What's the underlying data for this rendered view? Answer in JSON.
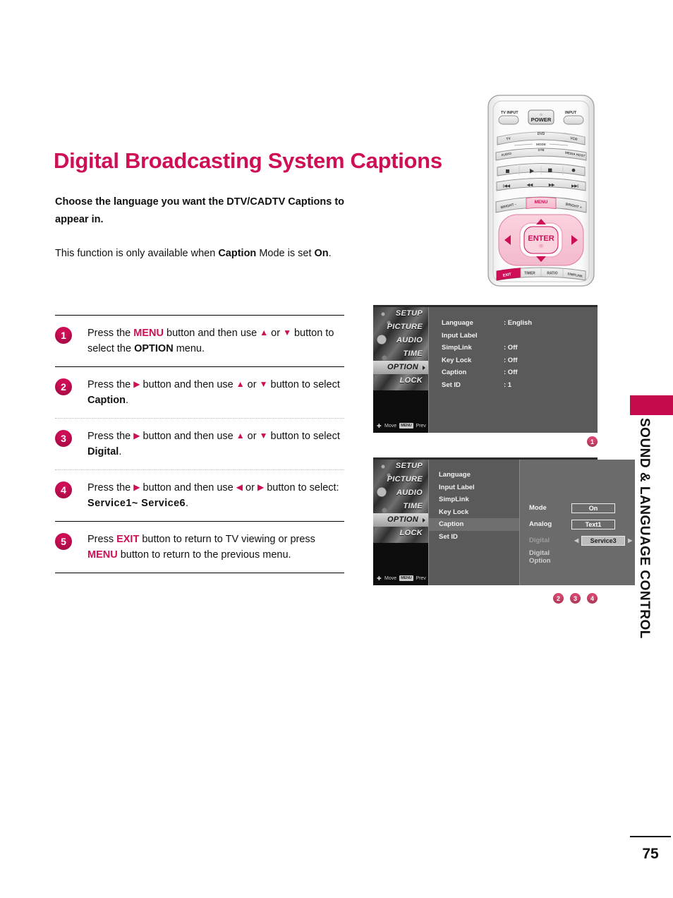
{
  "document": {
    "title": "Digital Broadcasting System Captions",
    "page_number": "75",
    "side_tab_title": "SOUND & LANGUAGE CONTROL"
  },
  "intro": {
    "paragraph1": "Choose the language you want the DTV/CADTV Captions to appear in.",
    "paragraph2_pre": "This function is only available when ",
    "paragraph2_bold1": "Caption",
    "paragraph2_mid": " Mode is set ",
    "paragraph2_bold2": "On",
    "paragraph2_post": "."
  },
  "steps": [
    {
      "number": "1",
      "segments": [
        {
          "t": "Press the ",
          "s": "plain"
        },
        {
          "t": "MENU",
          "s": "pink"
        },
        {
          "t": " button and then use ",
          "s": "plain"
        },
        {
          "t": "up-arrow",
          "s": "icon"
        },
        {
          "t": " or ",
          "s": "plain"
        },
        {
          "t": "down-arrow",
          "s": "icon"
        },
        {
          "t": " button to select the ",
          "s": "plain"
        },
        {
          "t": "OPTION",
          "s": "bold"
        },
        {
          "t": " menu.",
          "s": "plain"
        }
      ]
    },
    {
      "number": "2",
      "segments": [
        {
          "t": "Press the ",
          "s": "plain"
        },
        {
          "t": "right-arrow",
          "s": "icon"
        },
        {
          "t": " button and then use ",
          "s": "plain"
        },
        {
          "t": "up-arrow",
          "s": "icon"
        },
        {
          "t": " or ",
          "s": "plain"
        },
        {
          "t": "down-arrow",
          "s": "icon"
        },
        {
          "t": " button to select ",
          "s": "plain"
        },
        {
          "t": "Caption",
          "s": "bold"
        },
        {
          "t": ".",
          "s": "plain"
        }
      ]
    },
    {
      "number": "3",
      "segments": [
        {
          "t": "Press the ",
          "s": "plain"
        },
        {
          "t": "right-arrow",
          "s": "icon"
        },
        {
          "t": " button and then use ",
          "s": "plain"
        },
        {
          "t": "up-arrow",
          "s": "icon"
        },
        {
          "t": " or ",
          "s": "plain"
        },
        {
          "t": "down-arrow",
          "s": "icon"
        },
        {
          "t": " button to select ",
          "s": "plain"
        },
        {
          "t": "Digital",
          "s": "bold"
        },
        {
          "t": ".",
          "s": "plain"
        }
      ]
    },
    {
      "number": "4",
      "segments": [
        {
          "t": "Press the ",
          "s": "plain"
        },
        {
          "t": "right-arrow",
          "s": "icon"
        },
        {
          "t": " button and then use ",
          "s": "plain"
        },
        {
          "t": "left-arrow",
          "s": "icon"
        },
        {
          "t": " or ",
          "s": "plain"
        },
        {
          "t": "right-arrow",
          "s": "icon"
        },
        {
          "t": " button to select: ",
          "s": "plain"
        },
        {
          "t": "Service1~ Service6",
          "s": "service"
        },
        {
          "t": ".",
          "s": "plain"
        }
      ]
    },
    {
      "number": "5",
      "segments": [
        {
          "t": "Press ",
          "s": "plain"
        },
        {
          "t": "EXIT",
          "s": "pink"
        },
        {
          "t": " button to return to TV viewing or press ",
          "s": "plain"
        },
        {
          "t": "MENU",
          "s": "pink"
        },
        {
          "t": " button to return to the previous menu.",
          "s": "plain"
        }
      ]
    }
  ],
  "remote": {
    "tv_input": "TV INPUT",
    "power": "POWER",
    "input": "INPUT",
    "mode_label": "MODE",
    "source_row1": [
      "TV",
      "DVD",
      "VCR"
    ],
    "source_row2": [
      "AUDIO",
      "STB",
      "MEDIA HOST"
    ],
    "bright_minus": "BRIGHT -",
    "menu": "MENU",
    "bright_plus": "BRIGHT +",
    "enter": "ENTER",
    "exit": "EXIT",
    "timer": "TIMER",
    "ratio": "RATIO",
    "simplink": "SIMPLINK"
  },
  "osd_sidebar": {
    "items": [
      "SETUP",
      "PICTURE",
      "AUDIO",
      "TIME",
      "OPTION",
      "LOCK"
    ],
    "active": "OPTION",
    "footer_move": "Move",
    "footer_key": "MENU",
    "footer_prev": "Prev"
  },
  "osd1": {
    "rows": [
      {
        "label": "Language",
        "value": ": English"
      },
      {
        "label": "Input Label",
        "value": ""
      },
      {
        "label": "SimpLink",
        "value": ": Off"
      },
      {
        "label": "Key Lock",
        "value": ": Off"
      },
      {
        "label": "Caption",
        "value": ": Off"
      },
      {
        "label": "Set ID",
        "value": ": 1"
      }
    ],
    "marker": "1"
  },
  "osd2": {
    "list": [
      "Language",
      "Input Label",
      "SimpLink",
      "Key Lock",
      "Caption",
      "Set ID"
    ],
    "selected": "Caption",
    "detail": [
      {
        "label": "Mode",
        "value": "On",
        "state": "normal",
        "carets": false
      },
      {
        "label": "Analog",
        "value": "Text1",
        "state": "normal",
        "carets": false
      },
      {
        "label": "Digital",
        "value": "Service3",
        "state": "selected",
        "carets": true
      },
      {
        "label": "Digital Option",
        "value": "",
        "state": "dim",
        "carets": false
      }
    ],
    "markers": [
      "2",
      "3",
      "4"
    ]
  },
  "colors": {
    "accent": "#ce0e56",
    "marker": "#d6476f",
    "tab": "#c50b4e",
    "osd_bg": "#5a5a5a",
    "osd_detail_bg": "#6b6b6b"
  }
}
